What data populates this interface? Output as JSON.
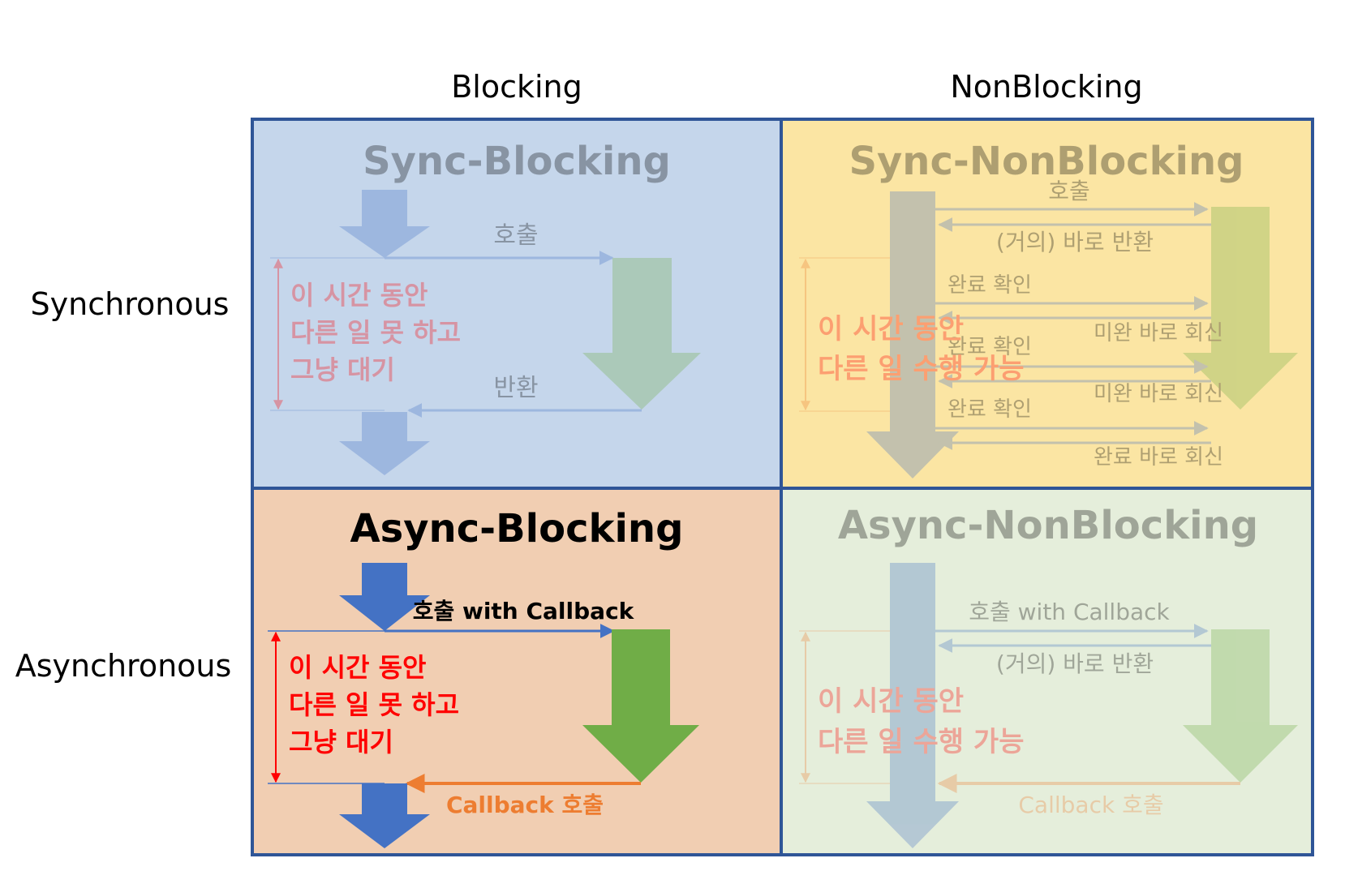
{
  "columns": {
    "blocking": "Blocking",
    "nonblocking": "NonBlocking"
  },
  "rows": {
    "synchronous": "Synchronous",
    "asynchronous": "Asynchronous"
  },
  "colors": {
    "border": "#2F5597",
    "sync_blocking_bg": "#C5D6EB",
    "sync_nonblocking_bg": "#FBE5A3",
    "async_blocking_bg": "#F1CEB2",
    "async_nonblocking_bg": "#E5EEDB",
    "blue_arrow": "#4472C4",
    "green_arrow": "#70AD47",
    "red_text": "#FF0000",
    "orange_arrow": "#ED7D31"
  },
  "sync_blocking": {
    "title": "Sync-Blocking",
    "call": "호출",
    "return": "반환",
    "wait_line1": "이 시간 동안",
    "wait_line2": "다른 일 못 하고",
    "wait_line3": "그냥 대기"
  },
  "sync_nonblocking": {
    "title": "Sync-NonBlocking",
    "call": "호출",
    "immediate_return": "(거의) 바로 반환",
    "check1": "완료 확인",
    "reply1": "미완 바로 회신",
    "check2": "완료 확인",
    "reply2": "미완 바로 회신",
    "check3": "완료 확인",
    "reply3": "완료 바로 회신",
    "can_line1": "이 시간 동안",
    "can_line2": "다른 일 수행 가능"
  },
  "async_blocking": {
    "title": "Async-Blocking",
    "call": "호출 with Callback",
    "callback": "Callback 호출",
    "wait_line1": "이 시간 동안",
    "wait_line2": "다른 일 못 하고",
    "wait_line3": "그냥 대기"
  },
  "async_nonblocking": {
    "title": "Async-NonBlocking",
    "call": "호출 with Callback",
    "immediate_return": "(거의) 바로 반환",
    "callback": "Callback 호출",
    "can_line1": "이 시간 동안",
    "can_line2": "다른 일 수행 가능"
  }
}
